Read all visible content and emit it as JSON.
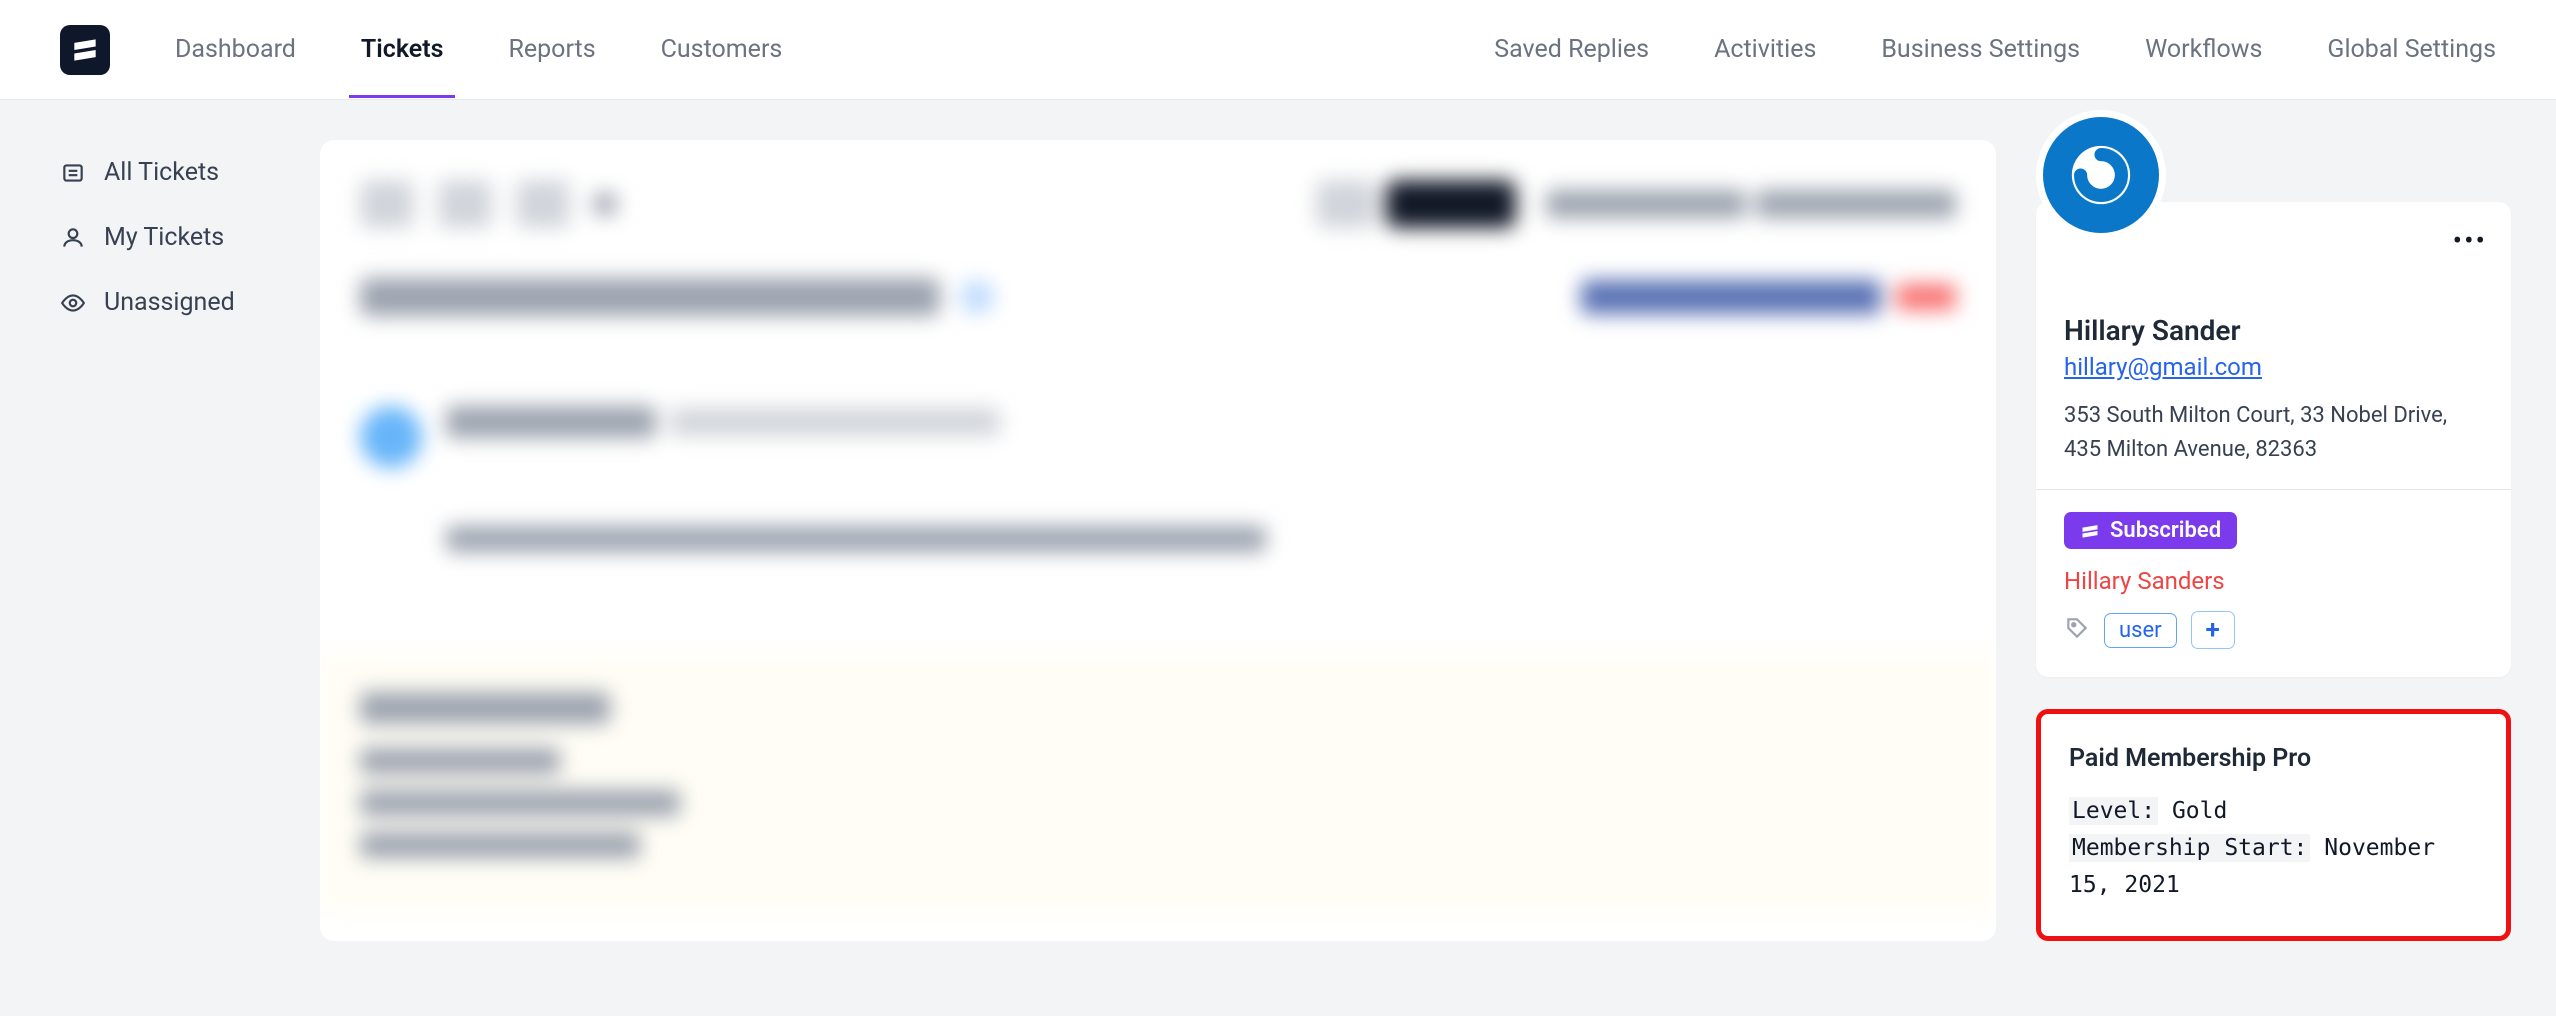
{
  "nav": {
    "left": [
      "Dashboard",
      "Tickets",
      "Reports",
      "Customers"
    ],
    "right": [
      "Saved Replies",
      "Activities",
      "Business Settings",
      "Workflows",
      "Global Settings"
    ],
    "active": "Tickets"
  },
  "sidebar": {
    "items": [
      {
        "label": "All Tickets",
        "icon": "list-icon"
      },
      {
        "label": "My Tickets",
        "icon": "user-icon"
      },
      {
        "label": "Unassigned",
        "icon": "eye-icon"
      }
    ]
  },
  "customer": {
    "name": "Hillary Sander",
    "email": "hillary@gmail.com",
    "address": "353 South Milton Court, 33 Nobel Drive, 435 Milton Avenue, 82363",
    "subscribed_label": "Subscribed",
    "subscribed_name": "Hillary Sanders",
    "tags": [
      "user"
    ]
  },
  "membership": {
    "title": "Paid Membership Pro",
    "level_label": "Level:",
    "level_value": "Gold",
    "start_label": "Membership Start:",
    "start_value": "November 15, 2021"
  }
}
